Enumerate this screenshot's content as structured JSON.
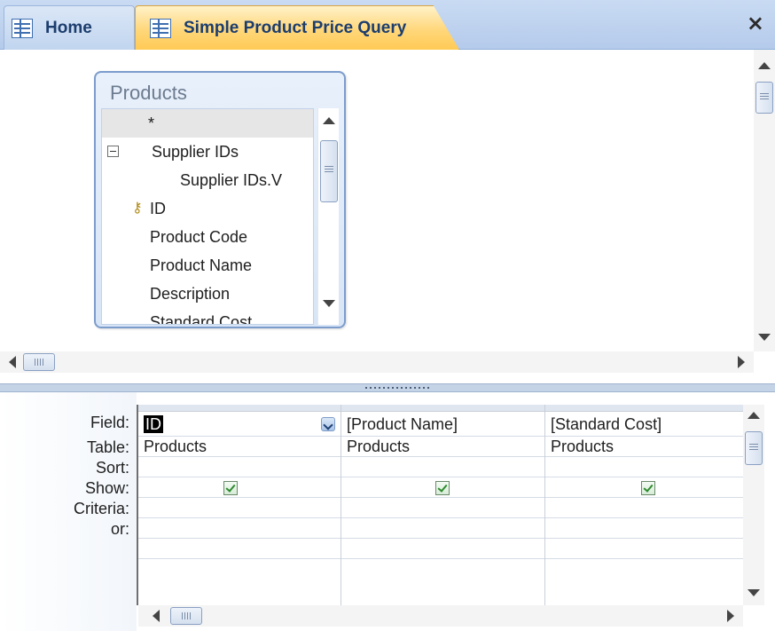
{
  "tabs": [
    {
      "label": "Home",
      "icon": "form-icon",
      "active": false
    },
    {
      "label": "Simple Product Price Query",
      "icon": "query-icon",
      "active": true
    }
  ],
  "close_symbol": "×",
  "table_box": {
    "title": "Products",
    "fields": [
      {
        "label": "*",
        "selected": true
      },
      {
        "label": "Supplier IDs",
        "expander": true
      },
      {
        "label": "Supplier IDs.V"
      },
      {
        "label": "ID",
        "primary_key": true
      },
      {
        "label": "Product Code"
      },
      {
        "label": "Product Name"
      },
      {
        "label": "Description"
      },
      {
        "label": "Standard Cost"
      }
    ]
  },
  "grid": {
    "row_labels": {
      "field": "Field:",
      "table": "Table:",
      "sort": "Sort:",
      "show": "Show:",
      "criteria": "Criteria:",
      "or": "or:"
    },
    "columns": [
      {
        "field": "ID",
        "table": "Products",
        "sort": "",
        "show": true,
        "criteria": "",
        "or": "",
        "field_selected": true
      },
      {
        "field": "[Product Name]",
        "table": "Products",
        "sort": "",
        "show": true,
        "criteria": "",
        "or": ""
      },
      {
        "field": "[Standard Cost]",
        "table": "Products",
        "sort": "",
        "show": true,
        "criteria": "",
        "or": ""
      }
    ]
  },
  "colors": {
    "active_tab": "#ffd77a",
    "tab_bar": "#c9dbf3",
    "table_border": "#7c9ccc",
    "checkbox_check": "#2d8a2d"
  }
}
